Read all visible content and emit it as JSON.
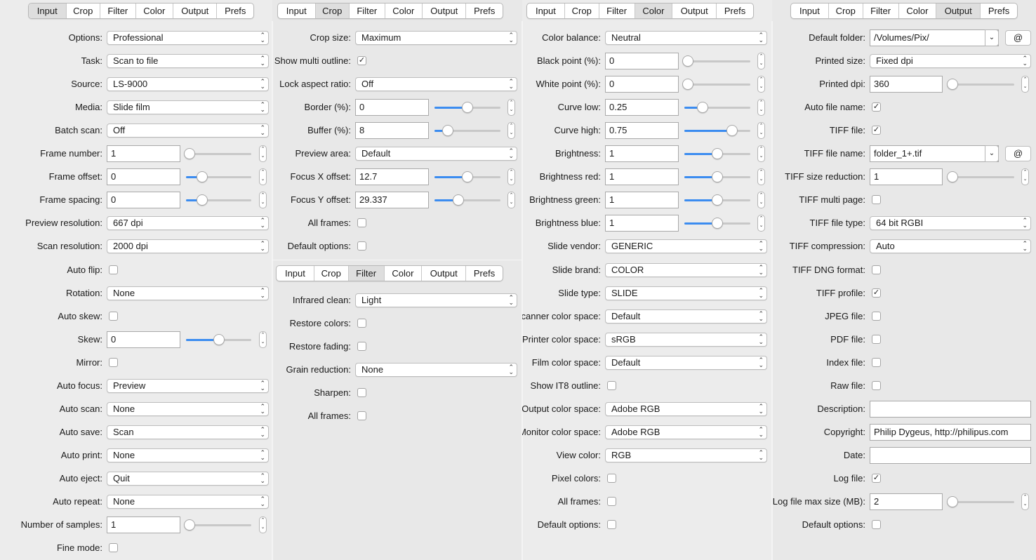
{
  "tabs": [
    "Input",
    "Crop",
    "Filter",
    "Color",
    "Output",
    "Prefs"
  ],
  "colors": {
    "accent": "#3b8cf0",
    "background": "#ececec"
  },
  "panels": [
    {
      "id": "input",
      "active_tab": "Input",
      "rows": [
        {
          "label": "Options:",
          "type": "select",
          "value": "Professional"
        },
        {
          "label": "Task:",
          "type": "select",
          "value": "Scan to file"
        },
        {
          "label": "Source:",
          "type": "select",
          "value": "LS-9000"
        },
        {
          "label": "Media:",
          "type": "select",
          "value": "Slide film"
        },
        {
          "label": "Batch scan:",
          "type": "select",
          "value": "Off"
        },
        {
          "label": "Frame number:",
          "type": "slider",
          "value": "1",
          "level": 0.05
        },
        {
          "label": "Frame offset:",
          "type": "slider",
          "value": "0",
          "level": 0.25
        },
        {
          "label": "Frame spacing:",
          "type": "slider",
          "value": "0",
          "level": 0.25
        },
        {
          "label": "Preview resolution:",
          "type": "select",
          "value": "667 dpi"
        },
        {
          "label": "Scan resolution:",
          "type": "select",
          "value": "2000 dpi"
        },
        {
          "label": "Auto flip:",
          "type": "checkbox",
          "checked": false
        },
        {
          "label": "Rotation:",
          "type": "select",
          "value": "None"
        },
        {
          "label": "Auto skew:",
          "type": "checkbox",
          "checked": false
        },
        {
          "label": "Skew:",
          "type": "slider",
          "value": "0",
          "level": 0.5
        },
        {
          "label": "Mirror:",
          "type": "checkbox",
          "checked": false
        },
        {
          "label": "Auto focus:",
          "type": "select",
          "value": "Preview"
        },
        {
          "label": "Auto scan:",
          "type": "select",
          "value": "None"
        },
        {
          "label": "Auto save:",
          "type": "select",
          "value": "Scan"
        },
        {
          "label": "Auto print:",
          "type": "select",
          "value": "None"
        },
        {
          "label": "Auto eject:",
          "type": "select",
          "value": "Quit"
        },
        {
          "label": "Auto repeat:",
          "type": "select",
          "value": "None"
        },
        {
          "label": "Number of samples:",
          "type": "slider",
          "value": "1",
          "level": 0.05
        },
        {
          "label": "Fine mode:",
          "type": "checkbox",
          "checked": false
        }
      ]
    },
    {
      "id": "crop",
      "active_tab": "Crop",
      "rows": [
        {
          "label": "Crop size:",
          "type": "select",
          "value": "Maximum"
        },
        {
          "label": "Show multi outline:",
          "type": "checkbox",
          "checked": true
        },
        {
          "label": "Lock aspect ratio:",
          "type": "select",
          "value": "Off"
        },
        {
          "label": "Border (%):",
          "type": "slider",
          "value": "0",
          "level": 0.5
        },
        {
          "label": "Buffer (%):",
          "type": "slider",
          "value": "8",
          "level": 0.2
        },
        {
          "label": "Preview area:",
          "type": "select",
          "value": "Default"
        },
        {
          "label": "Focus X offset:",
          "type": "slider",
          "value": "12.7",
          "level": 0.5
        },
        {
          "label": "Focus Y offset:",
          "type": "slider",
          "value": "29.337",
          "level": 0.36
        },
        {
          "label": "All frames:",
          "type": "checkbox",
          "checked": false
        },
        {
          "label": "Default options:",
          "type": "checkbox",
          "checked": false
        }
      ]
    },
    {
      "id": "filter",
      "active_tab": "Filter",
      "rows": [
        {
          "label": "Infrared clean:",
          "type": "select",
          "value": "Light"
        },
        {
          "label": "Restore colors:",
          "type": "checkbox",
          "checked": false
        },
        {
          "label": "Restore fading:",
          "type": "checkbox",
          "checked": false
        },
        {
          "label": "Grain reduction:",
          "type": "select",
          "value": "None"
        },
        {
          "label": "Sharpen:",
          "type": "checkbox",
          "checked": false
        },
        {
          "label": "All frames:",
          "type": "checkbox",
          "checked": false
        }
      ]
    },
    {
      "id": "color",
      "active_tab": "Color",
      "rows": [
        {
          "label": "Color balance:",
          "type": "select",
          "value": "Neutral"
        },
        {
          "label": "Black point (%):",
          "type": "slider",
          "value": "0",
          "level": 0.05
        },
        {
          "label": "White point (%):",
          "type": "slider",
          "value": "0",
          "level": 0.05
        },
        {
          "label": "Curve low:",
          "type": "slider",
          "value": "0.25",
          "level": 0.28
        },
        {
          "label": "Curve high:",
          "type": "slider",
          "value": "0.75",
          "level": 0.72
        },
        {
          "label": "Brightness:",
          "type": "slider",
          "value": "1",
          "level": 0.5
        },
        {
          "label": "Brightness red:",
          "type": "slider",
          "value": "1",
          "level": 0.5
        },
        {
          "label": "Brightness green:",
          "type": "slider",
          "value": "1",
          "level": 0.5
        },
        {
          "label": "Brightness blue:",
          "type": "slider",
          "value": "1",
          "level": 0.5
        },
        {
          "label": "Slide vendor:",
          "type": "select",
          "value": "GENERIC"
        },
        {
          "label": "Slide brand:",
          "type": "select",
          "value": "COLOR"
        },
        {
          "label": "Slide type:",
          "type": "select",
          "value": "SLIDE"
        },
        {
          "label": "Scanner color space:",
          "type": "select",
          "value": "Default"
        },
        {
          "label": "Printer color space:",
          "type": "select",
          "value": "sRGB"
        },
        {
          "label": "Film color space:",
          "type": "select",
          "value": "Default"
        },
        {
          "label": "Show IT8 outline:",
          "type": "checkbox",
          "checked": false
        },
        {
          "label": "Output color space:",
          "type": "select",
          "value": "Adobe RGB"
        },
        {
          "label": "Monitor color space:",
          "type": "select",
          "value": "Adobe RGB"
        },
        {
          "label": "View color:",
          "type": "select",
          "value": "RGB"
        },
        {
          "label": "Pixel colors:",
          "type": "checkbox",
          "checked": false
        },
        {
          "label": "All frames:",
          "type": "checkbox",
          "checked": false
        },
        {
          "label": "Default options:",
          "type": "checkbox",
          "checked": false
        }
      ]
    },
    {
      "id": "output",
      "active_tab": "Output",
      "rows": [
        {
          "label": "Default folder:",
          "type": "combo",
          "value": "/Volumes/Pix/",
          "button": "@"
        },
        {
          "label": "Printed size:",
          "type": "select",
          "value": "Fixed dpi"
        },
        {
          "label": "Printed dpi:",
          "type": "slider",
          "value": "360",
          "level": 0.05
        },
        {
          "label": "Auto file name:",
          "type": "checkbox",
          "checked": true
        },
        {
          "label": "TIFF file:",
          "type": "checkbox",
          "checked": true
        },
        {
          "label": "TIFF file name:",
          "type": "combo",
          "value": "folder_1+.tif",
          "button": "@"
        },
        {
          "label": "TIFF size reduction:",
          "type": "slider",
          "value": "1",
          "level": 0.05
        },
        {
          "label": "TIFF multi page:",
          "type": "checkbox",
          "checked": false
        },
        {
          "label": "TIFF file type:",
          "type": "select",
          "value": "64 bit RGBI"
        },
        {
          "label": "TIFF compression:",
          "type": "select",
          "value": "Auto"
        },
        {
          "label": "TIFF DNG format:",
          "type": "checkbox",
          "checked": false
        },
        {
          "label": "TIFF profile:",
          "type": "checkbox",
          "checked": true
        },
        {
          "label": "JPEG file:",
          "type": "checkbox",
          "checked": false
        },
        {
          "label": "PDF file:",
          "type": "checkbox",
          "checked": false
        },
        {
          "label": "Index file:",
          "type": "checkbox",
          "checked": false
        },
        {
          "label": "Raw file:",
          "type": "checkbox",
          "checked": false
        },
        {
          "label": "Description:",
          "type": "textfield",
          "value": ""
        },
        {
          "label": "Copyright:",
          "type": "textfield",
          "value": "Philip Dygeus, http://philipus.com"
        },
        {
          "label": "Date:",
          "type": "textfield",
          "value": ""
        },
        {
          "label": "Log file:",
          "type": "checkbox",
          "checked": true
        },
        {
          "label": "Log file max size (MB):",
          "type": "slider",
          "value": "2",
          "level": 0.05
        },
        {
          "label": "Default options:",
          "type": "checkbox",
          "checked": false
        }
      ]
    }
  ]
}
